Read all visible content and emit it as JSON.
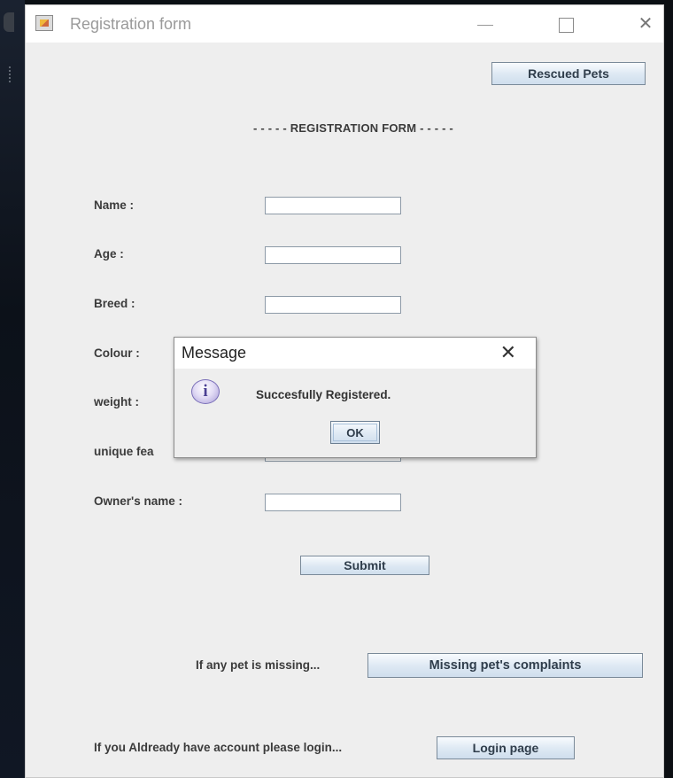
{
  "window": {
    "title": "Registration form",
    "controls": {
      "minimize": "—",
      "maximize": "☐",
      "close": "✕"
    }
  },
  "header": {
    "rescued_pets_button": "Rescued Pets",
    "form_heading": "- - - - - REGISTRATION FORM - - - - -"
  },
  "form": {
    "fields": [
      {
        "label": "Name :",
        "value": ""
      },
      {
        "label": "Age :",
        "value": ""
      },
      {
        "label": "Breed :",
        "value": ""
      },
      {
        "label": "Colour :",
        "value": ""
      },
      {
        "label": "weight :",
        "value": ""
      },
      {
        "label": "unique fea",
        "value": ""
      },
      {
        "label": "Owner's name :",
        "value": ""
      }
    ],
    "submit_button": "Submit"
  },
  "footer": {
    "missing_text": "If any pet is missing...",
    "missing_button": "Missing pet's complaints",
    "login_text": "If you Aldready have account please login...",
    "login_button": "Login page"
  },
  "dialog": {
    "title": "Message",
    "close": "✕",
    "icon": "info-icon",
    "icon_glyph": "i",
    "message": "Succesfully Registered.",
    "ok_button": "OK"
  }
}
